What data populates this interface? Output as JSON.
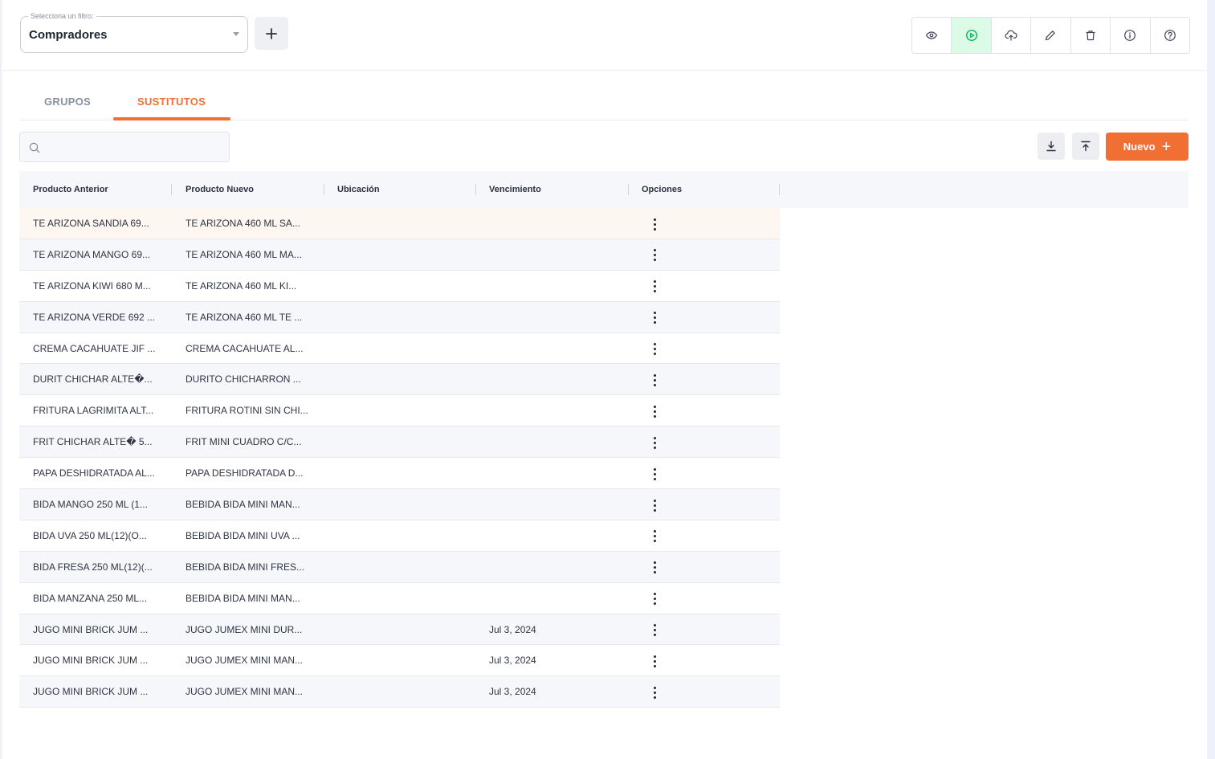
{
  "filter": {
    "legend": "Selecciona un filtro:",
    "value": "Compradores",
    "add_label": "+"
  },
  "toolbar": {
    "icons": [
      "eye-icon",
      "play-circle-icon",
      "cloud-upload-icon",
      "pencil-icon",
      "trash-icon",
      "info-icon",
      "help-icon"
    ],
    "active_color": "#dcfbe7"
  },
  "tabs": [
    {
      "label": "GRUPOS",
      "active": false
    },
    {
      "label": "SUSTITUTOS",
      "active": true
    }
  ],
  "search": {
    "placeholder": ""
  },
  "actions": {
    "new_label": "Nuevo",
    "new_icon": "+",
    "accent": "#f26f34"
  },
  "table": {
    "columns": [
      "Producto Anterior",
      "Producto Nuevo",
      "Ubicación",
      "Vencimiento",
      "Opciones"
    ],
    "rows": [
      {
        "anterior": "TE ARIZONA SANDIA 69...",
        "nuevo": "TE ARIZONA 460 ML SA...",
        "ubicacion": "",
        "vencimiento": ""
      },
      {
        "anterior": "TE ARIZONA MANGO 69...",
        "nuevo": "TE ARIZONA 460 ML MA...",
        "ubicacion": "",
        "vencimiento": ""
      },
      {
        "anterior": "TE ARIZONA KIWI 680 M...",
        "nuevo": "TE ARIZONA 460 ML KI...",
        "ubicacion": "",
        "vencimiento": ""
      },
      {
        "anterior": "TE ARIZONA VERDE 692 ...",
        "nuevo": "TE ARIZONA 460 ML TE ...",
        "ubicacion": "",
        "vencimiento": ""
      },
      {
        "anterior": "CREMA CACAHUATE JIF ...",
        "nuevo": "CREMA CACAHUATE AL...",
        "ubicacion": "",
        "vencimiento": ""
      },
      {
        "anterior": "DURIT CHICHAR ALTE�...",
        "nuevo": "DURITO CHICHARRON ...",
        "ubicacion": "",
        "vencimiento": ""
      },
      {
        "anterior": "FRITURA LAGRIMITA ALT...",
        "nuevo": "FRITURA ROTINI SIN CHI...",
        "ubicacion": "",
        "vencimiento": ""
      },
      {
        "anterior": "FRIT CHICHAR ALTE� 5...",
        "nuevo": "FRIT MINI CUADRO C/C...",
        "ubicacion": "",
        "vencimiento": ""
      },
      {
        "anterior": "PAPA DESHIDRATADA AL...",
        "nuevo": "PAPA DESHIDRATADA D...",
        "ubicacion": "",
        "vencimiento": ""
      },
      {
        "anterior": "BIDA MANGO 250 ML (1...",
        "nuevo": "BEBIDA BIDA MINI MAN...",
        "ubicacion": "",
        "vencimiento": ""
      },
      {
        "anterior": "BIDA UVA 250 ML(12)(O...",
        "nuevo": "BEBIDA BIDA MINI UVA ...",
        "ubicacion": "",
        "vencimiento": ""
      },
      {
        "anterior": "BIDA FRESA 250 ML(12)(...",
        "nuevo": "BEBIDA BIDA MINI FRES...",
        "ubicacion": "",
        "vencimiento": ""
      },
      {
        "anterior": "BIDA MANZANA 250 ML...",
        "nuevo": "BEBIDA BIDA MINI MAN...",
        "ubicacion": "",
        "vencimiento": ""
      },
      {
        "anterior": "JUGO MINI BRICK JUM ...",
        "nuevo": "JUGO JUMEX MINI DUR...",
        "ubicacion": "",
        "vencimiento": "Jul 3, 2024"
      },
      {
        "anterior": "JUGO MINI BRICK JUM ...",
        "nuevo": "JUGO JUMEX MINI MAN...",
        "ubicacion": "",
        "vencimiento": "Jul 3, 2024"
      },
      {
        "anterior": "JUGO MINI BRICK JUM ...",
        "nuevo": "JUGO JUMEX MINI MAN...",
        "ubicacion": "",
        "vencimiento": "Jul 3, 2024"
      }
    ]
  }
}
